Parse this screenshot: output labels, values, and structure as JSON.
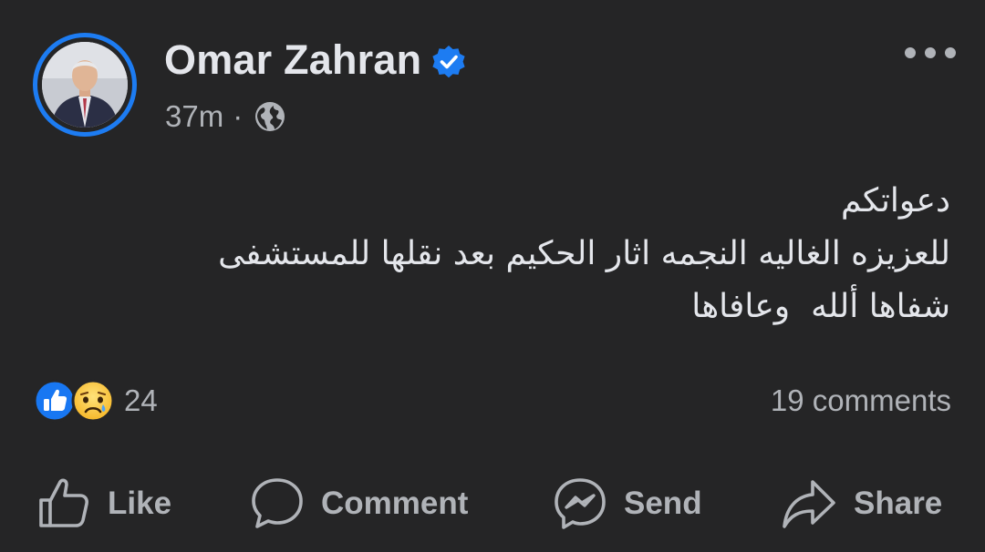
{
  "post": {
    "author": "Omar Zahran",
    "time": "37m",
    "separator": "·",
    "privacy_icon": "globe-icon",
    "verified_icon": "verified-badge-icon",
    "more_icon": "more-options-icon",
    "text_lines": [
      "دعواتكم",
      "للعزيزه الغاليه النجمه اثار الحكيم بعد نقلها للمستشفى ",
      "شفاها ألله  وعافاها"
    ]
  },
  "reactions": {
    "icons": [
      "like-reaction-icon",
      "sad-reaction-icon"
    ],
    "count": "24"
  },
  "comments": "19 comments",
  "actions": {
    "like": "Like",
    "comment": "Comment",
    "send": "Send",
    "share": "Share"
  },
  "colors": {
    "background": "#252526",
    "text_primary": "#e4e6eb",
    "text_secondary": "#b0b3b8",
    "accent_blue": "#1d7cf2"
  }
}
